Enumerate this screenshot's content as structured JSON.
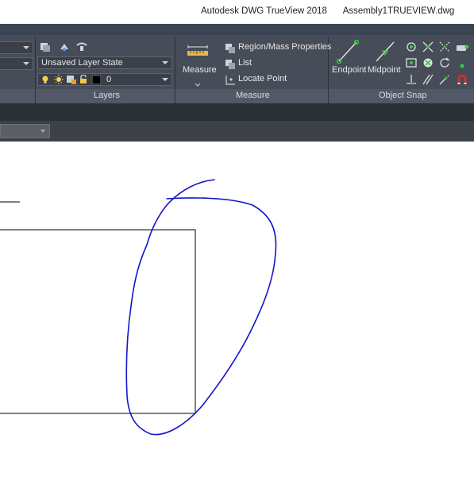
{
  "titlebar": {
    "app_title": "Autodesk DWG TrueView 2018",
    "file_name": "Assembly1TRUEVIEW.dwg"
  },
  "layers": {
    "layer_state_value": "Unsaved Layer State",
    "current_layer_value": "0",
    "current_layer_color": "#000000",
    "panel_title": "Layers"
  },
  "measure": {
    "measure_label": "Measure",
    "region_mass_label": "Region/Mass Properties",
    "list_label": "List",
    "locate_point_label": "Locate Point",
    "panel_title": "Measure"
  },
  "object_snap": {
    "endpoint_label": "Endpoint",
    "midpoint_label": "Midpoint",
    "panel_title": "Object Snap"
  },
  "colors": {
    "ribbon_bg": "#464c58",
    "annotation_stroke": "#1515cc",
    "drawing_stroke": "#000000",
    "snap_green": "#3cc83c",
    "snap_red": "#d03030"
  }
}
